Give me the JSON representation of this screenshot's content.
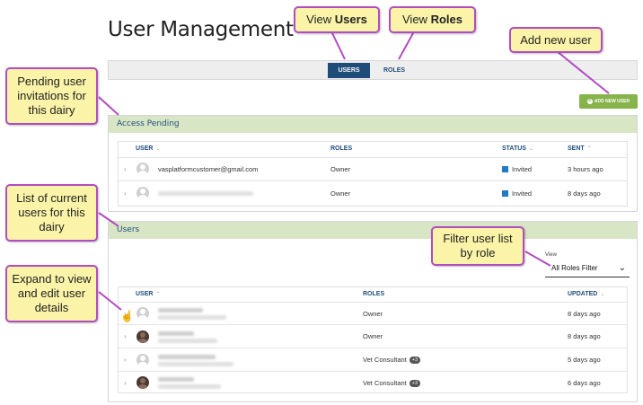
{
  "page": {
    "title": "User Management"
  },
  "tabs": [
    {
      "label": "USERS",
      "active": true
    },
    {
      "label": "ROLES",
      "active": false
    }
  ],
  "add_button": {
    "label": "ADD NEW USER"
  },
  "pending": {
    "title": "Access Pending",
    "headers": {
      "user": "USER",
      "roles": "ROLES",
      "status": "STATUS",
      "sent": "SENT"
    },
    "rows": [
      {
        "user": "vasplatformcustomer@gmail.com",
        "role": "Owner",
        "status": "Invited",
        "sent": "3 hours ago"
      },
      {
        "user": "",
        "role": "Owner",
        "status": "Invited",
        "sent": "8 days ago"
      }
    ]
  },
  "users": {
    "title": "Users",
    "headers": {
      "user": "USER",
      "roles": "ROLES",
      "updated": "UPDATED"
    },
    "filter": {
      "label": "View",
      "value": "All Roles Filter"
    },
    "rows": [
      {
        "role": "Owner",
        "badge": "",
        "updated": "8 days ago"
      },
      {
        "role": "Owner",
        "badge": "",
        "updated": "8 days ago"
      },
      {
        "role": "Vet Consultant",
        "badge": "+3",
        "updated": "5 days ago"
      },
      {
        "role": "Vet Consultant",
        "badge": "+3",
        "updated": "6 days ago"
      }
    ]
  },
  "callouts": {
    "view_users_prefix": "View ",
    "view_users_bold": "Users",
    "view_roles_prefix": "View ",
    "view_roles_bold": "Roles",
    "add_new_user": "Add new user",
    "pending": "Pending user invitations for this dairy",
    "current": "List of current users for this dairy",
    "filter": "Filter user list by role",
    "expand": "Expand to view and edit user details"
  },
  "colors": {
    "accent": "#1e4d7a",
    "panel_header": "#d9e6c6",
    "add_button": "#86b34a",
    "callout_fill": "#fbf4a8",
    "callout_border": "#b14cc2",
    "status_dot": "#1e7bc4"
  }
}
